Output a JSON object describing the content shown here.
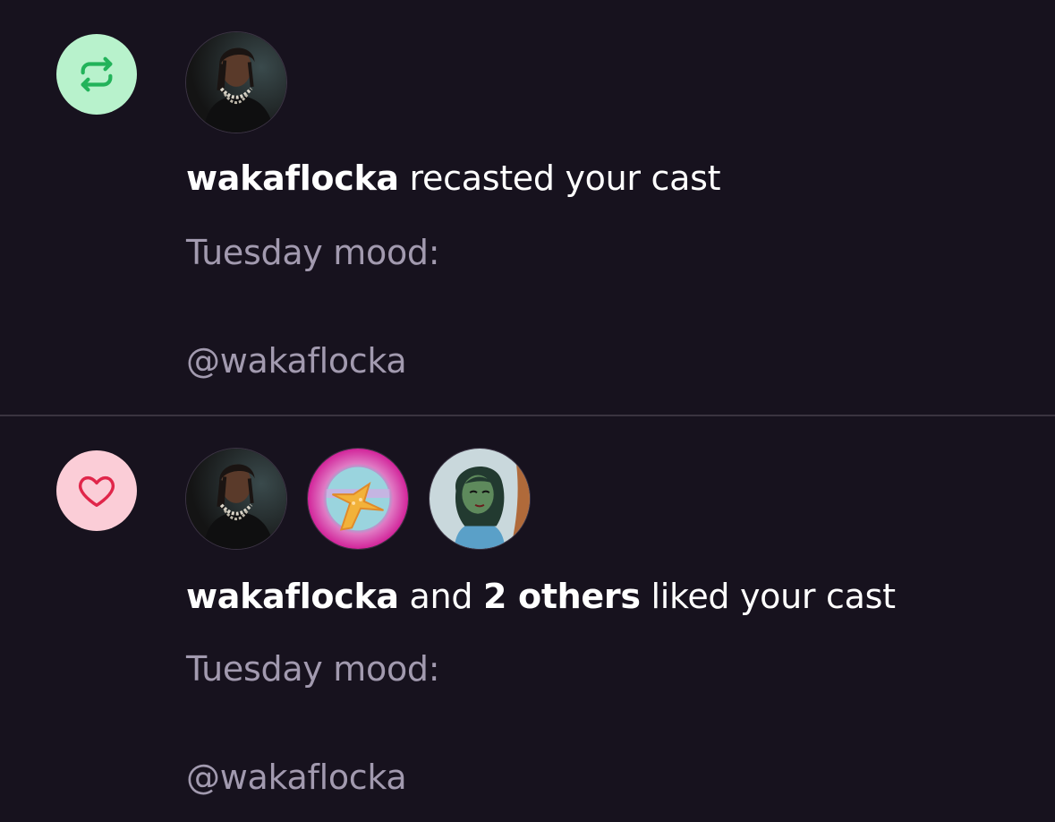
{
  "colors": {
    "background": "#17121e",
    "recast_badge_bg": "#b8f2cc",
    "recast_icon": "#22b35a",
    "like_badge_bg": "#fbcdd7",
    "like_icon": "#e0264a",
    "secondary_text": "#a29aaf",
    "divider": "#3a3440"
  },
  "notifications": [
    {
      "type": "recast",
      "icon": "recast-icon",
      "actor": "wakaflocka",
      "action_text": " recasted your cast",
      "cast_line1": "Tuesday mood:",
      "cast_line2": "@wakaflocka",
      "avatars": [
        "wakaflocka-avatar"
      ]
    },
    {
      "type": "like",
      "icon": "heart-icon",
      "actor": "wakaflocka",
      "and_text": " and ",
      "others": "2 others",
      "action_text": " liked your cast",
      "cast_line1": "Tuesday mood:",
      "cast_line2": "@wakaflocka",
      "avatars": [
        "wakaflocka-avatar",
        "starfish-avatar",
        "cartoon-girl-avatar"
      ]
    }
  ]
}
